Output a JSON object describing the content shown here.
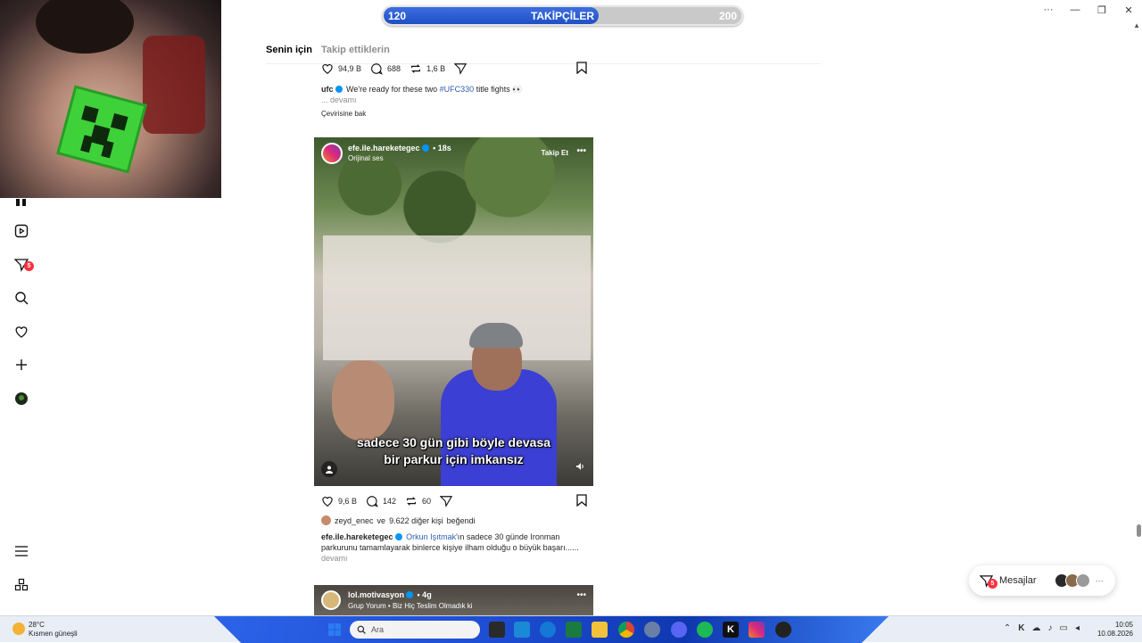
{
  "window": {
    "minimize": "—",
    "restore": "❐",
    "close": "✕",
    "more": "···"
  },
  "follower_bar": {
    "min": "120",
    "title": "TAKİPÇİLER",
    "max": "200",
    "progress_fraction": 0.6
  },
  "nav": {
    "notifications_badge": "5"
  },
  "tabs": {
    "for_you": "Senin için",
    "following": "Takip ettiklerin"
  },
  "post1": {
    "likes": "94,9 B",
    "comments": "688",
    "reposts": "1,6 B",
    "username": "ufc",
    "caption": "We're ready for these two",
    "hashtag": "#UFC330",
    "caption_end": "title fights 👀",
    "more": "... devamı",
    "translate": "Çevirisine bak"
  },
  "post2": {
    "username": "efe.ile.hareketegec",
    "time": "• 18s",
    "audio": "Orijinal ses",
    "follow": "Takip Et",
    "more_menu": "•••",
    "subtitle_line1": "sadece 30 gün gibi böyle devasa",
    "subtitle_line2": "bir parkur için imkansız",
    "likes": "9,6 B",
    "comments": "142",
    "reposts": "60",
    "liked_user": "zeyd_enec",
    "liked_and": "ve",
    "liked_others": "9.622 diğer kişi",
    "liked_suffix": "beğendi",
    "caption_user": "efe.ile.hareketegec",
    "caption_mention": "Orkun Işıtmak",
    "caption_text": "'ın sadece 30 günde Ironman parkurunu tamamlayarak binlerce kişiye ilham olduğu o büyük başarı......",
    "caption_more": "devamı"
  },
  "post3": {
    "username": "lol.motivasyon",
    "time": "• 4g",
    "sub": "Grup Yorum • Biz Hiç Teslim Olmadık ki",
    "more_menu": "•••"
  },
  "messages": {
    "label": "Mesajlar",
    "badge": "5",
    "more": "···"
  },
  "taskbar": {
    "temp": "28°C",
    "weather": "Kısmen güneşli",
    "search": "Ara",
    "time": "10:05",
    "date": "10.08.2026"
  },
  "colors": {
    "accent": "#0095f6",
    "badge": "#ff3040",
    "follower_fill": "#1f4fc4"
  }
}
